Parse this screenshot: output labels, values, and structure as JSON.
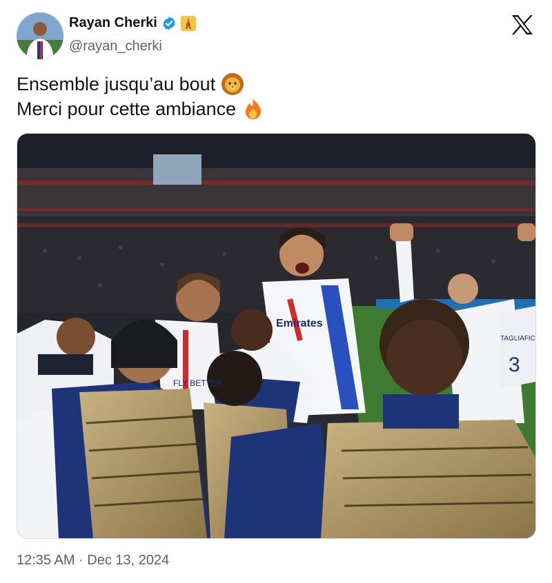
{
  "tweet": {
    "display_name": "Rayan Cherki",
    "handle": "@rayan_cherki",
    "lines": [
      "Ensemble jusqu’au bout",
      "Merci pour cette ambiance"
    ],
    "line_emoji": [
      "lion-face-emoji",
      "fire-emoji"
    ],
    "timestamp": "12:35 AM · Dec 13, 2024"
  },
  "icons": {
    "verified": "verified-badge-icon",
    "flag": "eiffel-tower-emoji",
    "brand": "x-logo-icon"
  },
  "colors": {
    "verified_blue": "#1d9bf0",
    "text_primary": "#0f1419",
    "text_secondary": "#536471"
  },
  "media": {
    "kind": "photo",
    "subject": "Lyon players celebrating in the stadium",
    "photo_text": {
      "sponsor": "Emirates",
      "fly_better": "FLY BETTER",
      "shirt_name": "TAGLIAFICO",
      "shirt_number": "3"
    }
  }
}
